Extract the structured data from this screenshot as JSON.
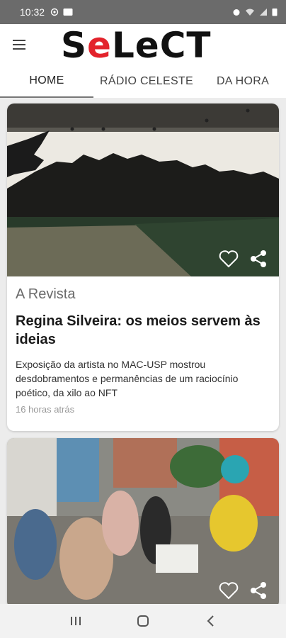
{
  "status_bar": {
    "time": "10:32",
    "icons_left": [
      "at-icon",
      "news-icon"
    ],
    "icons_right": [
      "alarm-icon",
      "wifi-icon",
      "signal-icon",
      "battery-icon"
    ]
  },
  "header": {
    "logo_prefix": "S",
    "logo_accent": "e",
    "logo_suffix": "LeCT",
    "accent_color": "#e3232c"
  },
  "tabs": [
    {
      "label": "HOME",
      "active": true
    },
    {
      "label": "RÁDIO CELESTE",
      "active": false
    },
    {
      "label": "DA HORA",
      "active": false
    }
  ],
  "articles": [
    {
      "section": "A Revista",
      "title": "Regina Silveira: os meios servem às ideias",
      "summary": "Exposição da artista no MAC-USP mostrou desdobramentos e permanências de um raciocínio poético, da xilo ao NFT",
      "time": "16 horas atrás"
    },
    {
      "section": "",
      "title": "",
      "summary": "",
      "time": ""
    }
  ],
  "nav": {
    "recents": "recents-icon",
    "home": "home-icon",
    "back": "back-icon"
  }
}
